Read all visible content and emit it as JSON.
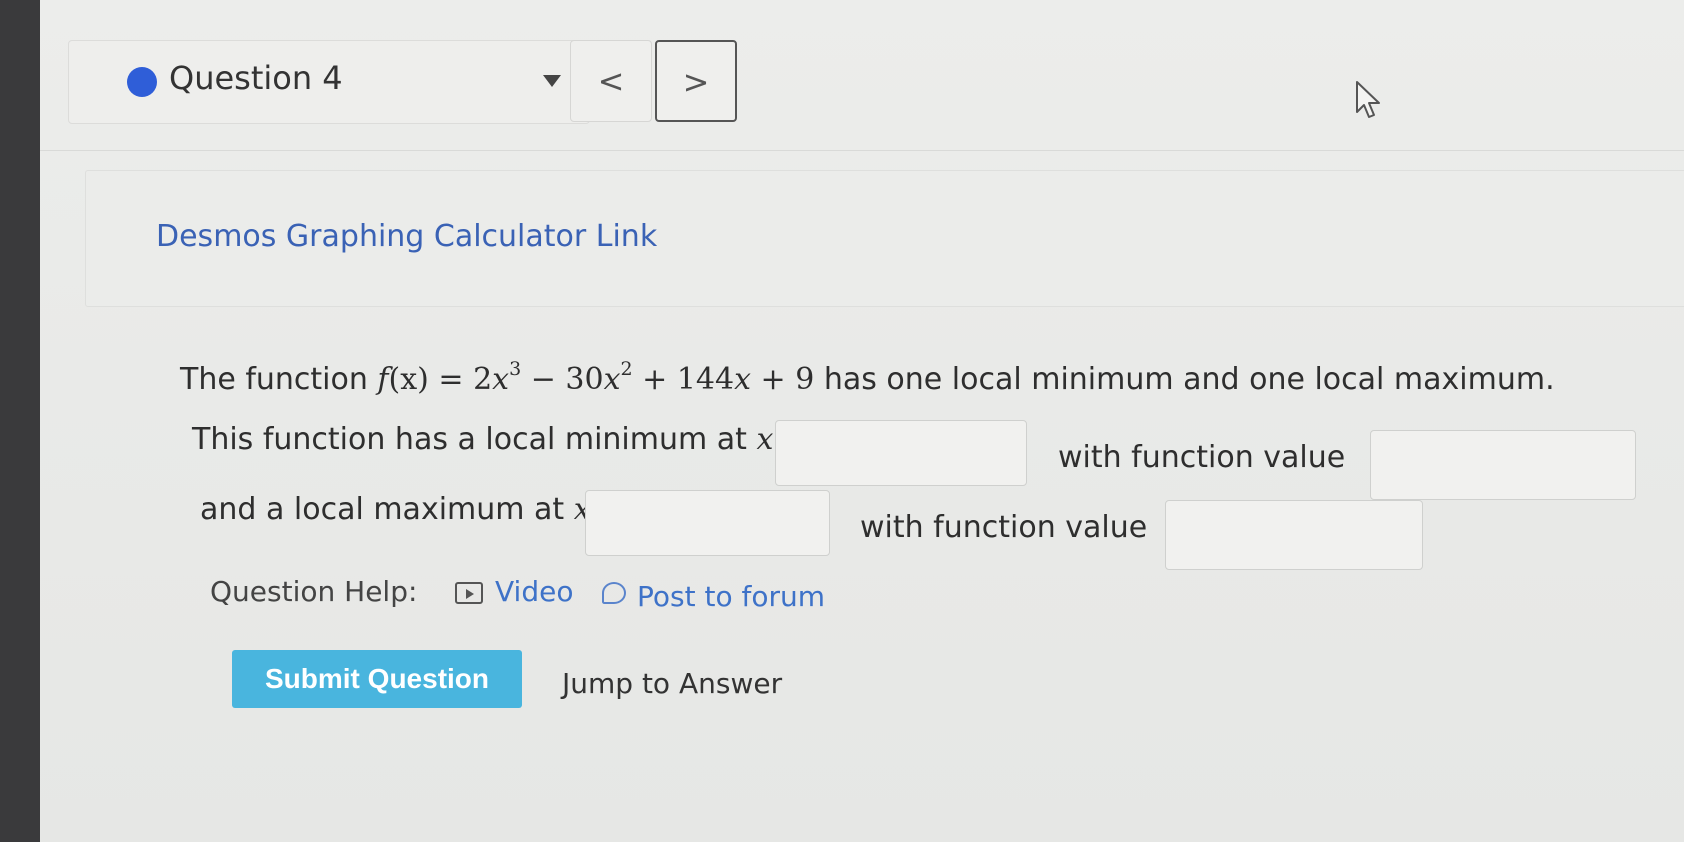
{
  "question_nav": {
    "label": "Question 4",
    "prev_symbol": "<",
    "next_symbol": ">"
  },
  "panel": {
    "desmos_link": "Desmos Graphing Calculator Link"
  },
  "problem": {
    "intro": "The function ",
    "fx_name": "f",
    "fx_arg": "(x)",
    "eq": " = ",
    "term1_coef": "2",
    "term1_var": "x",
    "term1_exp": "3",
    "minus": " − ",
    "term2_coef": "30",
    "term2_var": "x",
    "term2_exp": "2",
    "plus1": " + ",
    "term3": "144",
    "term3_var": "x",
    "plus2": " + ",
    "term4": "9",
    "tail": " has one local minimum and one local maximum.",
    "min_prefix": "This function has a local minimum at ",
    "min_var": "x",
    "min_eq": " =",
    "with_value_1": "with function value",
    "max_prefix": "and a local maximum at ",
    "max_var": "x",
    "max_eq": " =",
    "with_value_2": "with function value"
  },
  "answers": {
    "min_x": "",
    "min_fx": "",
    "max_x": "",
    "max_fx": ""
  },
  "help": {
    "label": "Question Help:",
    "video": "Video",
    "forum": "Post to forum"
  },
  "actions": {
    "submit": "Submit Question",
    "jump": "Jump to Answer"
  }
}
